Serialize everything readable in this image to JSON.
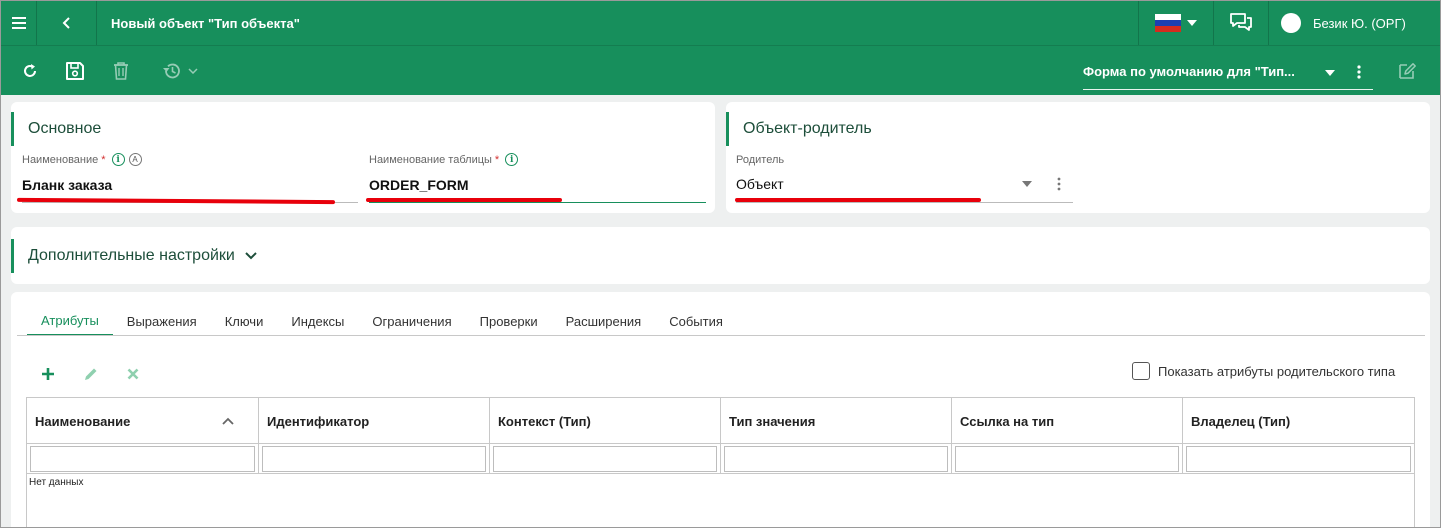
{
  "header": {
    "title": "Новый объект \"Тип объекта\"",
    "user": "Безик Ю. (ОРГ)",
    "flag": "russia-flag-icon"
  },
  "toolbar": {
    "form_selector": "Форма по умолчанию для \"Тип..."
  },
  "main_section": {
    "title": "Основное",
    "name_label": "Наименование",
    "name_value": "Бланк заказа",
    "table_label": "Наименование таблицы",
    "table_value": "ORDER_FORM",
    "required_mark": "*"
  },
  "parent_section": {
    "title": "Объект-родитель",
    "parent_label": "Родитель",
    "parent_value": "Объект"
  },
  "extra_section": {
    "title": "Дополнительные настройки"
  },
  "tabs": [
    {
      "label": "Атрибуты"
    },
    {
      "label": "Выражения"
    },
    {
      "label": "Ключи"
    },
    {
      "label": "Индексы"
    },
    {
      "label": "Ограничения"
    },
    {
      "label": "Проверки"
    },
    {
      "label": "Расширения"
    },
    {
      "label": "События"
    }
  ],
  "grid": {
    "show_parent_attrs": "Показать атрибуты родительского типа",
    "columns": [
      {
        "label": "Наименование"
      },
      {
        "label": "Идентификатор"
      },
      {
        "label": "Контекст (Тип)"
      },
      {
        "label": "Тип значения"
      },
      {
        "label": "Ссылка на тип"
      },
      {
        "label": "Владелец (Тип)"
      }
    ],
    "empty_text": "Нет данных"
  },
  "colors": {
    "primary": "#178f5c",
    "highlight": "#e8000b"
  }
}
